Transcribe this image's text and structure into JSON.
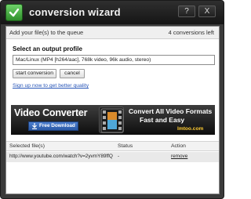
{
  "window": {
    "title": "conversion wizard",
    "help_label": "?",
    "close_label": "X"
  },
  "queue": {
    "instruction": "Add your file(s) to the queue",
    "conversions_left": "4 conversions left"
  },
  "profile": {
    "label": "Select an output profile",
    "selected": "Mac/Linux (MP4 [h264/aac], 768k video, 96k audio, stereo)"
  },
  "actions": {
    "start_label": "start conversion",
    "cancel_label": "cancel",
    "signup_label": "Sign up now to get better quality"
  },
  "banner": {
    "title": "Video Converter",
    "download_label": "Free Download",
    "headline": "Convert All Video Formats",
    "subline": "Fast and Easy",
    "site": "Imtoo.com"
  },
  "table": {
    "columns": [
      "Selected file(s)",
      "Status",
      "Action"
    ],
    "rows": [
      {
        "file": "http://www.youtube.com/watch?v=2yvmY89ffQ",
        "status": "-",
        "action": "remove"
      }
    ]
  },
  "colors": {
    "accent_green": "#2e8e2a",
    "link_blue": "#2856b8",
    "banner_gold": "#ffcc33"
  },
  "icons": [
    "app-logo-icon",
    "download-icon",
    "film-icon"
  ]
}
